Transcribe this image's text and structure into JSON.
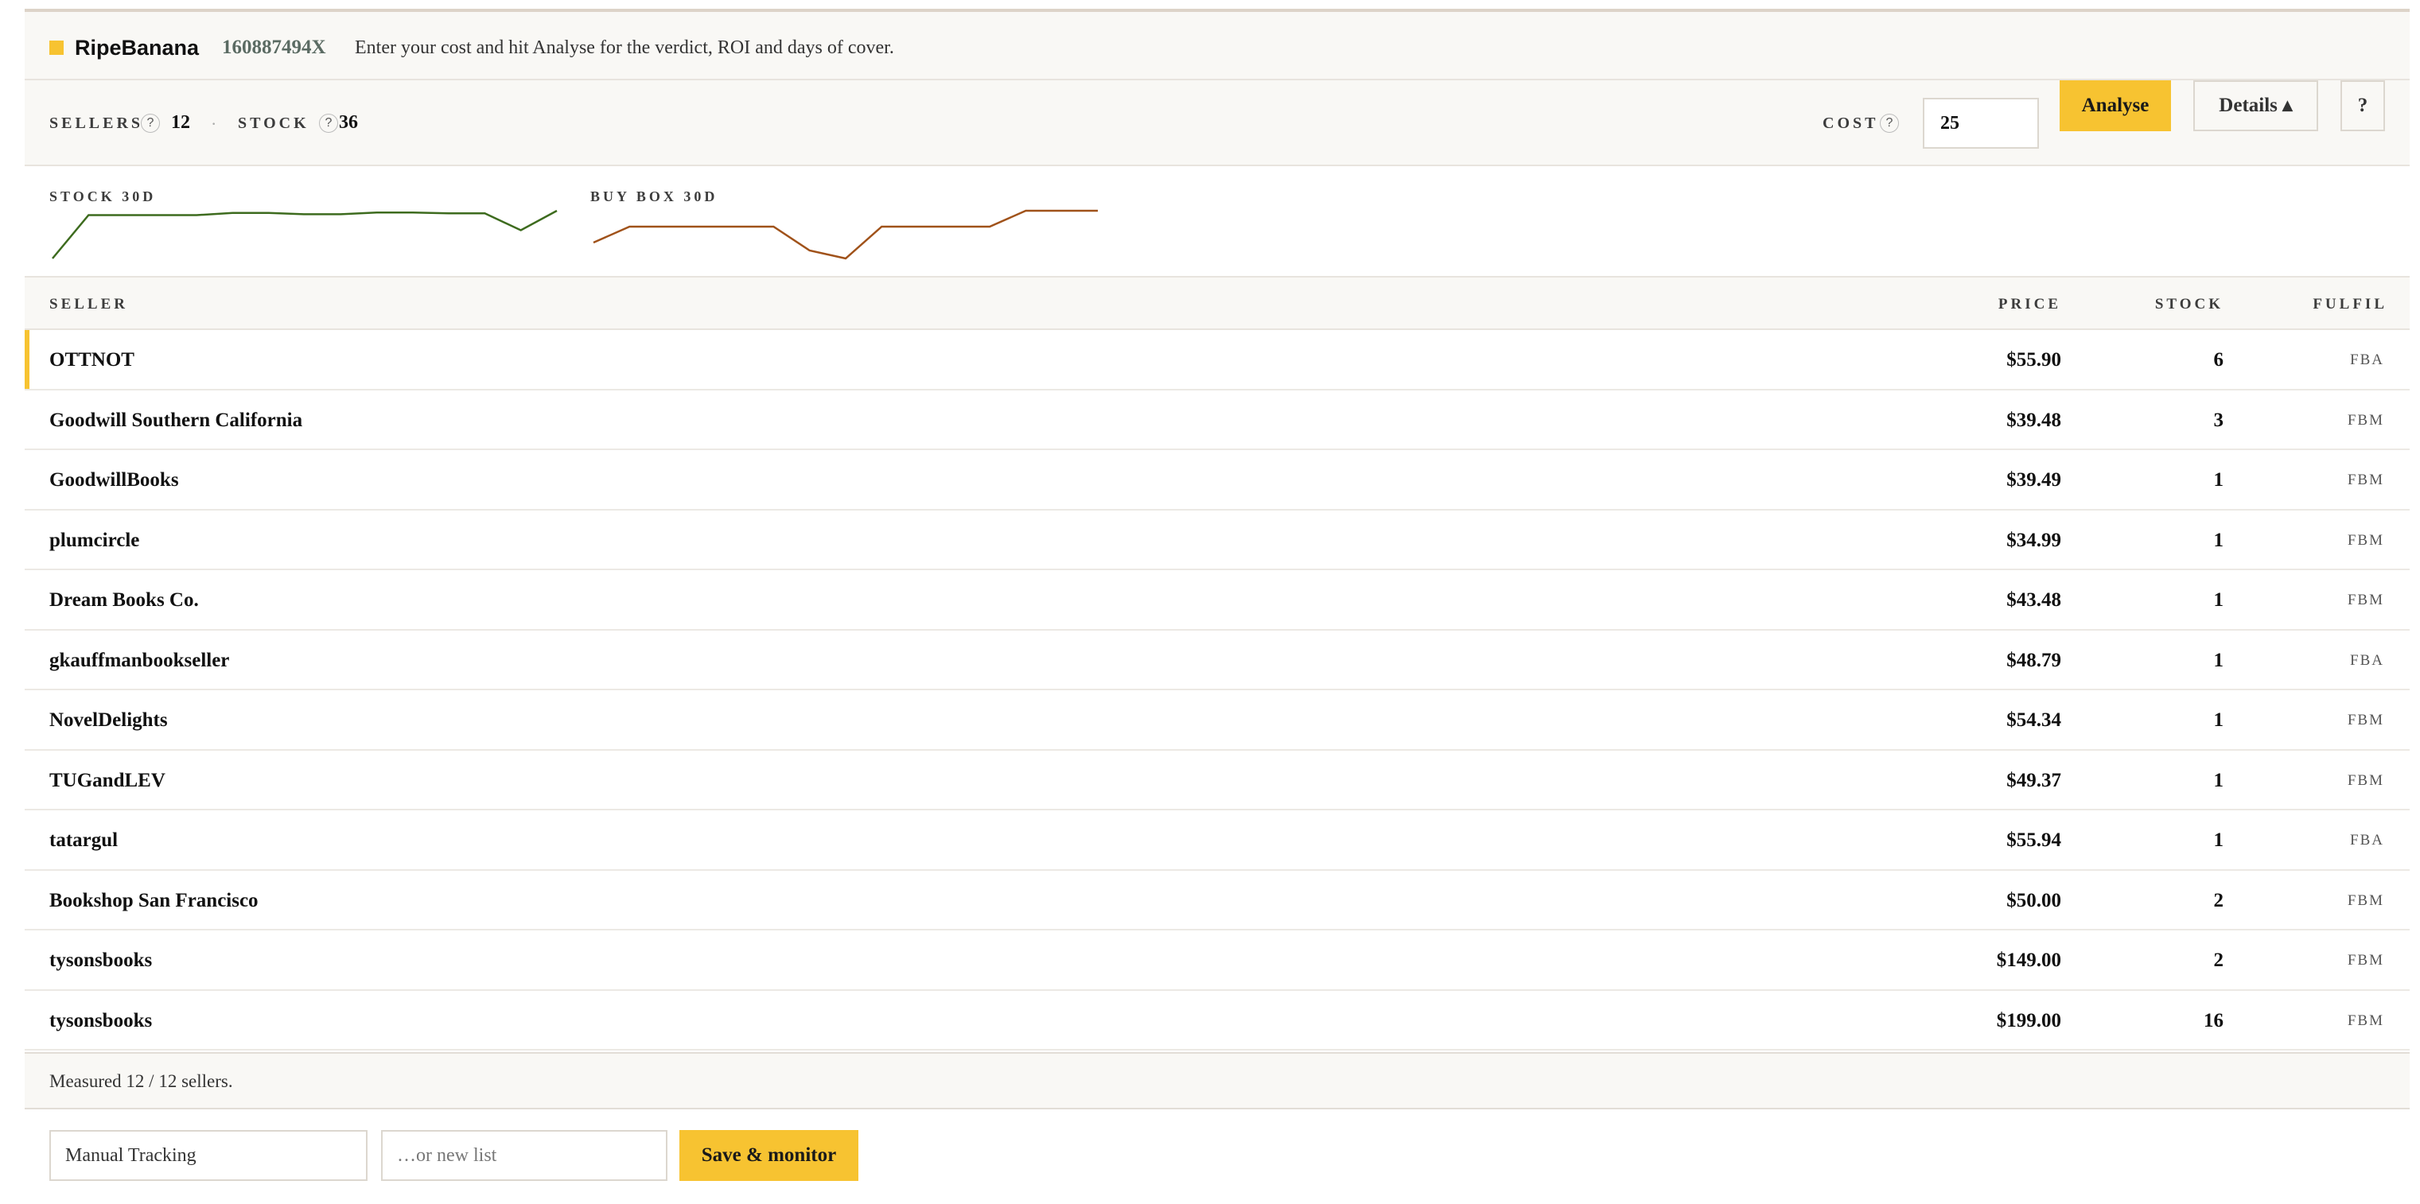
{
  "header": {
    "brand": "RipeBanana",
    "isbn": "160887494X",
    "hint": "Enter your cost and hit Analyse for the verdict, ROI and days of cover."
  },
  "controls": {
    "sellers_label": "SELLERS",
    "sellers_value": "12",
    "separator": "·",
    "stock_label": "STOCK",
    "stock_value": "36",
    "help_glyph": "?",
    "cost_label": "COST",
    "cost_value": "25",
    "analyse_label": "Analyse",
    "details_label": "Details ▴",
    "help_button_label": "?"
  },
  "sparklines": {
    "stock": {
      "label": "STOCK 30D",
      "color": "#3d6b1e",
      "values": [
        0,
        10,
        10,
        10,
        10,
        10.5,
        10.5,
        10.2,
        10.2,
        10.6,
        10.6,
        10.4,
        10.4,
        6.5,
        11
      ]
    },
    "buybox": {
      "label": "BUY BOX 30D",
      "color": "#a0521a",
      "values": [
        39.3,
        39.5,
        39.5,
        39.5,
        39.5,
        39.5,
        39.2,
        39.1,
        39.5,
        39.5,
        39.5,
        39.5,
        39.7,
        39.7,
        39.7
      ]
    }
  },
  "table": {
    "columns": {
      "seller": "SELLER",
      "price": "PRICE",
      "stock": "STOCK",
      "fulfil": "FULFIL"
    },
    "rows": [
      {
        "seller": "OTTNOT",
        "price": "$55.90",
        "stock": "6",
        "fulfil": "FBA",
        "highlight": true
      },
      {
        "seller": "Goodwill Southern California",
        "price": "$39.48",
        "stock": "3",
        "fulfil": "FBM"
      },
      {
        "seller": "GoodwillBooks",
        "price": "$39.49",
        "stock": "1",
        "fulfil": "FBM"
      },
      {
        "seller": "plumcircle",
        "price": "$34.99",
        "stock": "1",
        "fulfil": "FBM"
      },
      {
        "seller": "Dream Books Co.",
        "price": "$43.48",
        "stock": "1",
        "fulfil": "FBM"
      },
      {
        "seller": "gkauffmanbookseller",
        "price": "$48.79",
        "stock": "1",
        "fulfil": "FBA"
      },
      {
        "seller": "NovelDelights",
        "price": "$54.34",
        "stock": "1",
        "fulfil": "FBM"
      },
      {
        "seller": "TUGandLEV",
        "price": "$49.37",
        "stock": "1",
        "fulfil": "FBM"
      },
      {
        "seller": "tatargul",
        "price": "$55.94",
        "stock": "1",
        "fulfil": "FBA"
      },
      {
        "seller": "Bookshop San Francisco",
        "price": "$50.00",
        "stock": "2",
        "fulfil": "FBM"
      },
      {
        "seller": "tysonsbooks",
        "price": "$149.00",
        "stock": "2",
        "fulfil": "FBM"
      },
      {
        "seller": "tysonsbooks",
        "price": "$199.00",
        "stock": "16",
        "fulfil": "FBM"
      }
    ]
  },
  "footer": {
    "measured": "Measured 12 / 12 sellers.",
    "list_value": "Manual Tracking",
    "new_list_placeholder": "…or new list",
    "save_label": "Save & monitor"
  },
  "colors": {
    "accent": "#f7c331",
    "panel_bg": "#f9f8f5",
    "border": "#e8e4de"
  }
}
